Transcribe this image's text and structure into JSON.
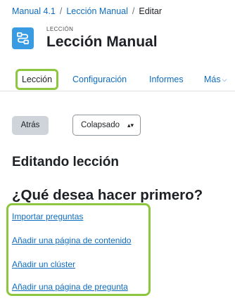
{
  "breadcrumb": {
    "course": "Manual 4.1",
    "lesson": "Lección Manual",
    "current": "Editar",
    "separator": "/"
  },
  "header": {
    "icon": "lesson-icon",
    "kicker": "LECCIÓN",
    "title": "Lección Manual",
    "icon_color": "#399be2"
  },
  "tabs": [
    {
      "label": "Lección",
      "active": true
    },
    {
      "label": "Configuración",
      "active": false
    },
    {
      "label": "Informes",
      "active": false
    },
    {
      "label": "Más",
      "active": false,
      "icon": "chevron-down-icon"
    }
  ],
  "toolbar": {
    "back_label": "Atrás",
    "mode_select_value": "Colapsado"
  },
  "main": {
    "heading": "Editando lección",
    "prompt": "¿Qué desea hacer primero?",
    "options": [
      "Importar preguntas",
      "Añadir una página de contenido",
      "Añadir un clúster",
      "Añadir una página de pregunta"
    ]
  },
  "colors": {
    "link": "#0f6cbf",
    "highlight": "#8dc63f",
    "text": "#1d2125"
  }
}
